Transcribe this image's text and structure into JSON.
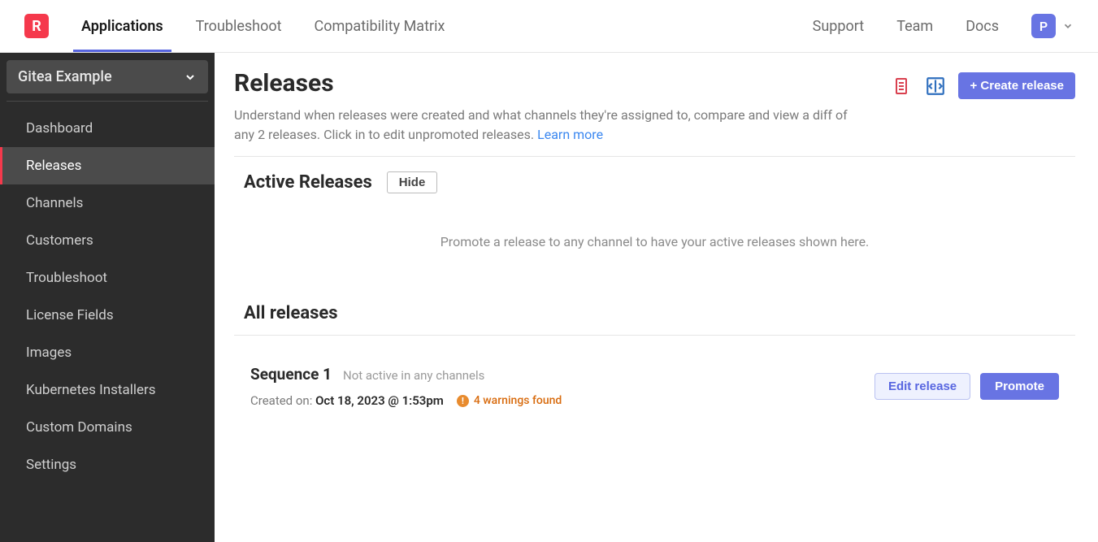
{
  "brand": {
    "logo_letter": "R",
    "avatar_letter": "P"
  },
  "top_nav": {
    "left": [
      {
        "label": "Applications",
        "active": true
      },
      {
        "label": "Troubleshoot",
        "active": false
      },
      {
        "label": "Compatibility Matrix",
        "active": false
      }
    ],
    "right": [
      {
        "label": "Support"
      },
      {
        "label": "Team"
      },
      {
        "label": "Docs"
      }
    ]
  },
  "sidebar": {
    "app_name": "Gitea Example",
    "items": [
      {
        "label": "Dashboard",
        "active": false
      },
      {
        "label": "Releases",
        "active": true
      },
      {
        "label": "Channels",
        "active": false
      },
      {
        "label": "Customers",
        "active": false
      },
      {
        "label": "Troubleshoot",
        "active": false
      },
      {
        "label": "License Fields",
        "active": false
      },
      {
        "label": "Images",
        "active": false
      },
      {
        "label": "Kubernetes Installers",
        "active": false
      },
      {
        "label": "Custom Domains",
        "active": false
      },
      {
        "label": "Settings",
        "active": false
      }
    ]
  },
  "page": {
    "title": "Releases",
    "description": "Understand when releases were created and what channels they're assigned to, compare and view a diff of any 2 releases. Click in to edit unpromoted releases.",
    "learn_more": "Learn more",
    "create_button": "+ Create release",
    "active_section_title": "Active Releases",
    "hide_button": "Hide",
    "empty_message": "Promote a release to any channel to have your active releases shown here.",
    "all_section_title": "All releases"
  },
  "releases": [
    {
      "label": "Sequence 1",
      "status": "Not active in any channels",
      "created_label": "Created on:",
      "created_value": "Oct 18, 2023 @ 1:53pm",
      "warnings": "4 warnings found",
      "edit_button": "Edit release",
      "promote_button": "Promote"
    }
  ]
}
